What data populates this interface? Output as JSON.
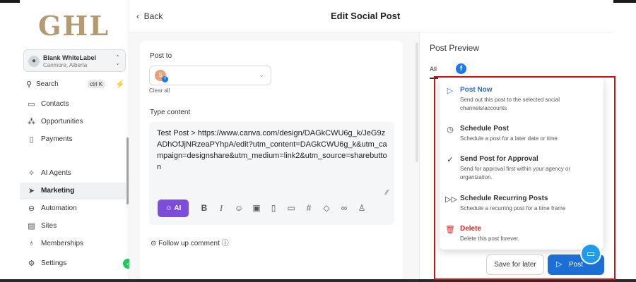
{
  "sidebar": {
    "logo": "GHL",
    "account": {
      "name": "Blank WhiteLabel",
      "location": "Canmore, Alberta"
    },
    "search": {
      "label": "Search",
      "shortcut": "ctrl K"
    },
    "items": [
      {
        "label": "Contacts",
        "icon": "contacts-icon"
      },
      {
        "label": "Opportunities",
        "icon": "opportunities-icon"
      },
      {
        "label": "Payments",
        "icon": "payments-icon"
      },
      {
        "label": "AI Agents",
        "icon": "ai-agents-icon"
      },
      {
        "label": "Marketing",
        "icon": "marketing-icon"
      },
      {
        "label": "Automation",
        "icon": "automation-icon"
      },
      {
        "label": "Sites",
        "icon": "sites-icon"
      },
      {
        "label": "Memberships",
        "icon": "memberships-icon"
      },
      {
        "label": "Settings",
        "icon": "settings-icon"
      }
    ]
  },
  "header": {
    "back_label": "Back",
    "title": "Edit Social Post"
  },
  "editor": {
    "post_to_label": "Post to",
    "account_initial": "S",
    "clear_all": "Clear all",
    "type_content_label": "Type content",
    "content": "Test Post > https://www.canva.com/design/DAGkCWU6g_k/JeG9zADhOfJjNRzeaPYhpA/edit?utm_content=DAGkCWU6g_k&utm_campaign=designshare&utm_medium=link2&utm_source=sharebutton",
    "ai_button": "AI",
    "follow_up": "Follow up comment"
  },
  "preview": {
    "title": "Post Preview",
    "tab_all": "All"
  },
  "menu": {
    "items": [
      {
        "title": "Post Now",
        "description": "Send out this post to the selected social channels/accounts"
      },
      {
        "title": "Schedule Post",
        "description": "Schedule a post for a later date or time"
      },
      {
        "title": "Send Post for Approval",
        "description": "Send for approval first within your agency or organization."
      },
      {
        "title": "Schedule Recurring Posts",
        "description": "Schedule a recurring post for a time frame"
      },
      {
        "title": "Delete",
        "description": "Delete this post forever."
      }
    ]
  },
  "actions": {
    "save_later": "Save for later",
    "post": "Post"
  },
  "colors": {
    "accent": "#1d6fd6",
    "ai": "#7c4ddb",
    "danger": "#dc2626",
    "highlight": "#d20f0f",
    "logo": "#b49a72"
  }
}
